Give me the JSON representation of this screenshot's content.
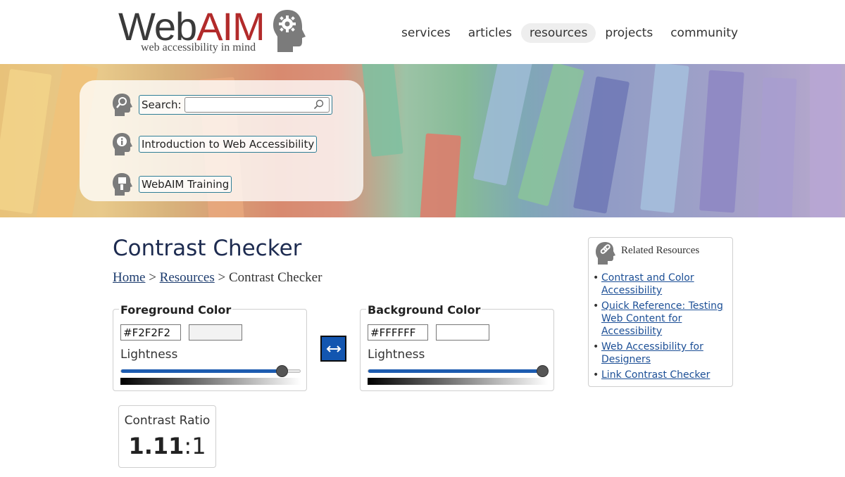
{
  "brand": {
    "word_web": "Web",
    "word_aim": "AIM",
    "tagline": "web accessibility in mind",
    "logo_icon": "head-gear-icon"
  },
  "nav": {
    "items": [
      {
        "label": "services",
        "active": false
      },
      {
        "label": "articles",
        "active": false
      },
      {
        "label": "resources",
        "active": true
      },
      {
        "label": "projects",
        "active": false
      },
      {
        "label": "community",
        "active": false
      }
    ]
  },
  "banner": {
    "search_label": "Search:",
    "search_value": "",
    "search_icon": "magnifier-icon",
    "intro_link": "Introduction to Web Accessibility",
    "training_link": "WebAIM Training"
  },
  "page": {
    "title": "Contrast Checker",
    "breadcrumb": {
      "home": "Home",
      "sep1": " > ",
      "resources": "Resources",
      "sep2": " > ",
      "current": "Contrast Checker"
    }
  },
  "foreground": {
    "legend": "Foreground Color",
    "hex": "#F2F2F2",
    "swatch_color": "#F2F2F2",
    "lightness_label": "Lightness",
    "lightness": 0.92
  },
  "background": {
    "legend": "Background Color",
    "hex": "#FFFFFF",
    "swatch_color": "#FFFFFF",
    "lightness_label": "Lightness",
    "lightness": 1.0
  },
  "swap": {
    "icon": "swap-arrows-icon",
    "accent": "#1356B0"
  },
  "ratio": {
    "label": "Contrast Ratio",
    "value": "1.11",
    "suffix": ":1"
  },
  "related": {
    "title": "Related Resources",
    "icon": "link-head-icon",
    "links": [
      "Contrast and Color Accessibility",
      "Quick Reference: Testing Web Content for Accessibility",
      "Web Accessibility for Designers",
      "Link Contrast Checker"
    ]
  }
}
